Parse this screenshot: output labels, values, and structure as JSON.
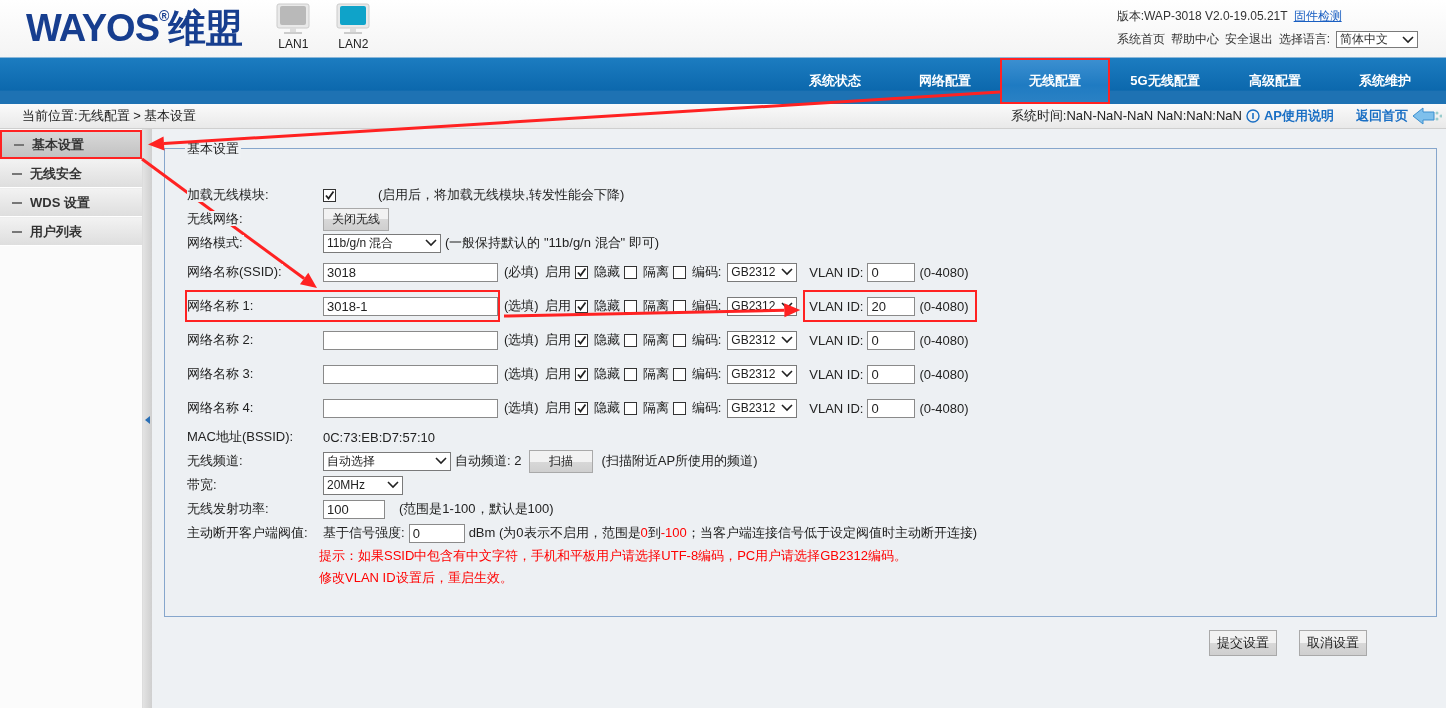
{
  "header": {
    "logo": "WAYOS$^{®}$维盟",
    "ports": [
      {
        "label": "LAN1",
        "connected": false
      },
      {
        "label": "LAN2",
        "connected": true
      }
    ],
    "version": "版本:WAP-3018 V2.0-19.05.21T",
    "firmware_link": "固件检测",
    "links": [
      "系统首页",
      "帮助中心",
      "安全退出"
    ],
    "language_label": "选择语言:",
    "language": "简体中文"
  },
  "nav_tabs": [
    {
      "label": "系统状态",
      "selected": false,
      "highlighted": false
    },
    {
      "label": "网络配置",
      "selected": false,
      "highlighted": false
    },
    {
      "label": "无线配置",
      "selected": true,
      "highlighted": true
    },
    {
      "label": "5G无线配置",
      "selected": false,
      "highlighted": false
    },
    {
      "label": "高级配置",
      "selected": false,
      "highlighted": false
    },
    {
      "label": "系统维护",
      "selected": false,
      "highlighted": false
    }
  ],
  "breadcrumb": "当前位置:无线配置 > 基本设置",
  "system_time": "系统时间:NaN-NaN-NaN NaN:NaN:NaN",
  "help_link": "AP使用说明",
  "home_link": "返回首页",
  "sidebar": {
    "items": [
      {
        "label": "基本设置",
        "selected": true,
        "highlighted": true
      },
      {
        "label": "无线安全",
        "selected": false,
        "highlighted": false
      },
      {
        "label": "WDS 设置",
        "selected": false,
        "highlighted": false
      },
      {
        "label": "用户列表",
        "selected": false,
        "highlighted": false
      }
    ]
  },
  "form": {
    "legend": "基本设置",
    "load_module": {
      "label": "加载无线模块:",
      "checked": true,
      "note": "(启用后，将加载无线模块,转发性能会下降)"
    },
    "wireless": {
      "label": "无线网络:",
      "button": "关闭无线"
    },
    "mode": {
      "label": "网络模式:",
      "value": "11b/g/n 混合",
      "note": "(一般保持默认的 \"11b/g/n 混合\" 即可)"
    },
    "ssids": [
      {
        "label": "网络名称(SSID):",
        "value": "3018",
        "hint": "(必填)",
        "enable_label": "启用",
        "enabled": true,
        "hide_label": "隐藏",
        "hidden": false,
        "isolate_label": "隔离",
        "isolated": false,
        "encoding_label": "编码:",
        "encoding": "GB2312",
        "vlan_label": "VLAN ID:",
        "vlan": "0",
        "vlan_range": "(0-4080)",
        "name_highlighted": false,
        "vlan_highlighted": false
      },
      {
        "label": "网络名称 1:",
        "value": "3018-1",
        "hint": "(选填)",
        "enable_label": "启用",
        "enabled": true,
        "hide_label": "隐藏",
        "hidden": false,
        "isolate_label": "隔离",
        "isolated": false,
        "encoding_label": "编码:",
        "encoding": "GB2312",
        "vlan_label": "VLAN ID:",
        "vlan": "20",
        "vlan_range": "(0-4080)",
        "name_highlighted": true,
        "vlan_highlighted": true
      },
      {
        "label": "网络名称 2:",
        "hint": "(选填)",
        "enable_label": "启用",
        "enabled": true,
        "hide_label": "隐藏",
        "hidden": false,
        "isolate_label": "隔离",
        "isolated": false,
        "encoding_label": "编码:",
        "encoding": "GB2312",
        "vlan_label": "VLAN ID:",
        "vlan": "0",
        "vlan_range": "(0-4080)",
        "name_highlighted": false,
        "vlan_highlighted": false
      },
      {
        "label": "网络名称 3:",
        "hint": "(选填)",
        "enable_label": "启用",
        "enabled": true,
        "hide_label": "隐藏",
        "hidden": false,
        "isolate_label": "隔离",
        "isolated": false,
        "encoding_label": "编码:",
        "encoding": "GB2312",
        "vlan_label": "VLAN ID:",
        "vlan": "0",
        "vlan_range": "(0-4080)",
        "name_highlighted": false,
        "vlan_highlighted": false
      },
      {
        "label": "网络名称 4:",
        "hint": "(选填)",
        "enable_label": "启用",
        "enabled": true,
        "hide_label": "隐藏",
        "hidden": false,
        "isolate_label": "隔离",
        "isolated": false,
        "encoding_label": "编码:",
        "encoding": "GB2312",
        "vlan_label": "VLAN ID:",
        "vlan": "0",
        "vlan_range": "(0-4080)",
        "name_highlighted": false,
        "vlan_highlighted": false
      }
    ],
    "mac": {
      "label": "MAC地址(BSSID):",
      "value": "0C:73:EB:D7:57:10"
    },
    "channel": {
      "label": "无线频道:",
      "value": "自动选择",
      "auto": "自动频道: 2",
      "button": "扫描",
      "note": "(扫描附近AP所使用的频道)"
    },
    "bandwidth": {
      "label": "带宽:",
      "value": "20MHz"
    },
    "power": {
      "label": "无线发射功率:",
      "value": "100",
      "note": "(范围是1-100，默认是100)"
    },
    "threshold": {
      "label": "主动断开客户端阀值:",
      "prefix": "基于信号强度:",
      "value": "0",
      "note_parts": [
        {
          "text": "dBm (为0表示不启用，范围是",
          "highlight": false
        },
        {
          "text": "0",
          "highlight": true
        },
        {
          "text": "到",
          "highlight": false
        },
        {
          "text": "-100",
          "highlight": true
        },
        {
          "text": "；当客户端连接信号低于设定阀值时主动断开连接)",
          "highlight": false
        }
      ]
    },
    "tips": [
      "提示：如果SSID中包含有中文字符，手机和平板用户请选择UTF-8编码，PC用户请选择GB2312编码。",
      "修改VLAN ID设置后，重启生效。"
    ]
  },
  "actions": [
    "提交设置",
    "取消设置"
  ]
}
